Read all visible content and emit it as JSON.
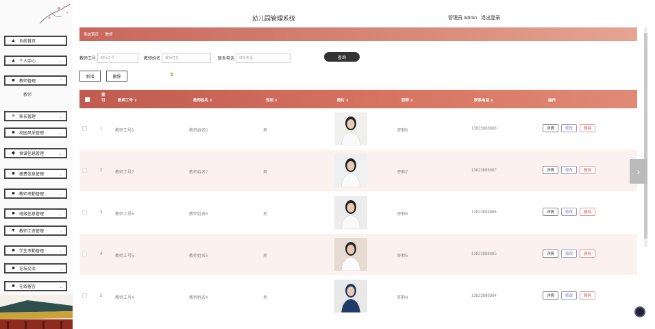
{
  "header": {
    "title": "幼儿园管理系统",
    "user": "管理员 admin",
    "logout": "退出登录"
  },
  "breadcrumb": {
    "home": "系统首页",
    "sep": ":",
    "current": "教师"
  },
  "sidebar": {
    "items": [
      {
        "label": "系统首页",
        "icon": "home-icon",
        "glyph": "▲"
      },
      {
        "label": "个人中心",
        "icon": "user-icon",
        "glyph": "▲"
      },
      {
        "label": "教师管理",
        "icon": "chat-icon",
        "glyph": "■"
      },
      {
        "label": "家长管理",
        "icon": "list-icon",
        "glyph": "≡"
      },
      {
        "label": "校园风采管理",
        "icon": "grid-icon",
        "glyph": "■"
      },
      {
        "label": "食谱信息管理",
        "icon": "location-icon",
        "glyph": "◆"
      },
      {
        "label": "缴费信息管理",
        "icon": "card-icon",
        "glyph": "■"
      },
      {
        "label": "教师考勤管理",
        "icon": "calendar-icon",
        "glyph": "■"
      },
      {
        "label": "班级信息管理",
        "icon": "grid-icon",
        "glyph": "■"
      },
      {
        "label": "教师工资管理",
        "icon": "money-icon",
        "glyph": "▼"
      },
      {
        "label": "学生考勤管理",
        "icon": "ticket-icon",
        "glyph": "■"
      },
      {
        "label": "论坛交流",
        "icon": "forum-icon",
        "glyph": "■"
      },
      {
        "label": "在线留言",
        "icon": "grid-icon",
        "glyph": "■"
      }
    ],
    "submenu": "教师"
  },
  "search": {
    "no_label": "教师工号",
    "no_placeholder": "教师工号",
    "name_label": "教师姓名",
    "name_placeholder": "教师姓名",
    "phone_label": "联系电话",
    "phone_placeholder": "联系电话",
    "button": "查询"
  },
  "actions": {
    "add": "新增",
    "delete": "删除"
  },
  "table": {
    "headers": [
      "索引",
      "教师工号 ⇕",
      "教师姓名 ⇕",
      "性别 ⇕",
      "照片 ⇕",
      "职称 ⇕",
      "联系电话 ⇕",
      "操作"
    ],
    "rows": [
      {
        "idx": "1",
        "no": "教师工号8",
        "name": "教师姓名8",
        "gender": "男",
        "title": "职称8",
        "phone": "13823888888"
      },
      {
        "idx": "2",
        "no": "教师工号7",
        "name": "教师姓名7",
        "gender": "男",
        "title": "职称7",
        "phone": "13823888887"
      },
      {
        "idx": "3",
        "no": "教师工号6",
        "name": "教师姓名6",
        "gender": "男",
        "title": "职称6",
        "phone": "13823888886"
      },
      {
        "idx": "4",
        "no": "教师工号5",
        "name": "教师姓名5",
        "gender": "男",
        "title": "职称5",
        "phone": "13823888885"
      },
      {
        "idx": "5",
        "no": "教师工号4",
        "name": "教师姓名4",
        "gender": "男",
        "title": "职称4",
        "phone": "13823888884"
      }
    ],
    "ops": {
      "detail": "详情",
      "edit": "修改",
      "delete": "删除"
    }
  }
}
